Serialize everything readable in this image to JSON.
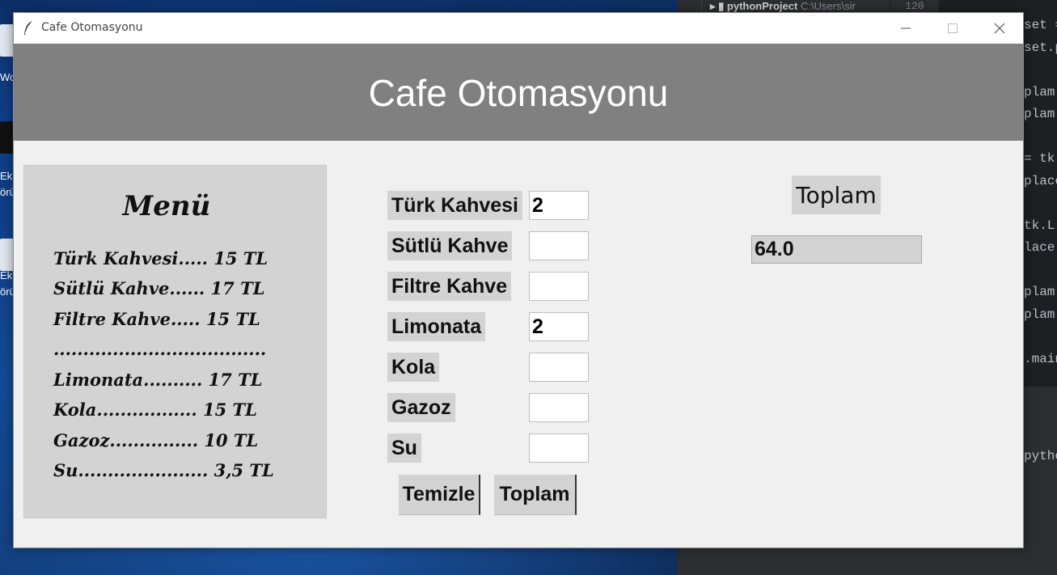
{
  "window": {
    "title": "Cafe Otomasyonu",
    "header_title": "Cafe Otomasyonu"
  },
  "menu": {
    "title": "Menü",
    "lines": [
      "Türk Kahvesi..... 15 TL",
      "Sütlü Kahve...... 17 TL",
      "Filtre Kahve..... 15 TL",
      "....................................",
      "Limonata.......... 17 TL",
      "Kola................. 15 TL",
      "Gazoz............... 10 TL",
      "Su...................... 3,5 TL"
    ]
  },
  "items": [
    {
      "label": "Türk Kahvesi",
      "value": "2"
    },
    {
      "label": "Sütlü Kahve",
      "value": ""
    },
    {
      "label": "Filtre Kahve",
      "value": ""
    },
    {
      "label": "Limonata",
      "value": "2"
    },
    {
      "label": "Kola",
      "value": ""
    },
    {
      "label": "Gazoz",
      "value": ""
    },
    {
      "label": "Su",
      "value": ""
    }
  ],
  "buttons": {
    "clear": "Temizle",
    "total": "Toplam"
  },
  "total": {
    "label": "Toplam",
    "value": "64.0"
  },
  "background": {
    "ide_project": "pythonProject",
    "ide_path": "C:\\Users\\sir",
    "ide_line": "120",
    "ide_code": [
      "set =",
      "set.p",
      "",
      "plam",
      "plam.",
      "",
      "= tk.",
      "place",
      "",
      "tk.L",
      "lace(",
      "",
      "plam",
      "plam.",
      "",
      ".main"
    ],
    "ide_run": "pytho",
    "desktop_labels": [
      "Wor",
      "Ek",
      "örü",
      "Ek",
      "örü"
    ]
  }
}
